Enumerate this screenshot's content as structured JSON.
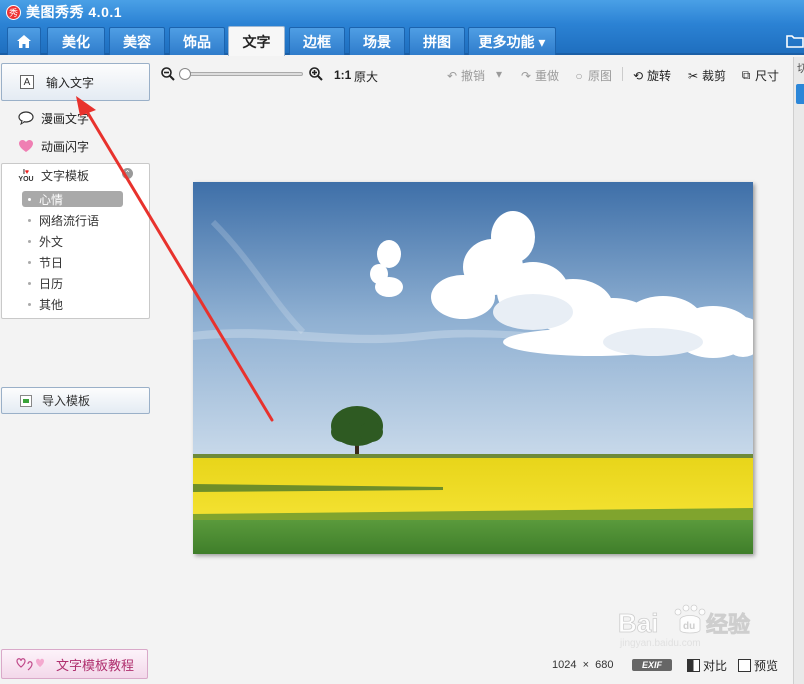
{
  "app": {
    "logo_glyph": "秀",
    "title": "美图秀秀 4.0.1"
  },
  "tabs": [
    {
      "label": "",
      "icon": "home-icon"
    },
    {
      "label": "美化"
    },
    {
      "label": "美容"
    },
    {
      "label": "饰品"
    },
    {
      "label": "文字",
      "active": true
    },
    {
      "label": "边框"
    },
    {
      "label": "场景"
    },
    {
      "label": "拼图"
    },
    {
      "label": "更多功能 ▾"
    }
  ],
  "left_panel": {
    "input_text_icon": "A",
    "input_text_label": "输入文字",
    "comic_text_label": "漫画文字",
    "animated_text_label": "动画闪字",
    "template_header": "文字模板",
    "categories": [
      "心情",
      "网络流行语",
      "外文",
      "节日",
      "日历",
      "其他"
    ],
    "selected_category": "心情",
    "import_label": "导入模板",
    "tutorial_label": "文字模板教程"
  },
  "toolbar": {
    "ratio": "1:1",
    "original_size": "原大",
    "undo": "撤销",
    "redo": "重做",
    "original_image": "原图",
    "rotate": "旋转",
    "crop": "裁剪",
    "size": "尺寸",
    "zoom_level": 0.0
  },
  "status": {
    "width": "1024",
    "times": "×",
    "height": "680",
    "exif": "EXIF",
    "compare": "对比",
    "preview": "预览"
  },
  "right_edge_text": "切",
  "watermark": {
    "brand": "Baidu",
    "suffix": "经验",
    "url": "jingyan.baidu.com"
  },
  "colors": {
    "titlebar": "#2b82d4",
    "accent": "#2b82d4",
    "annotation_arrow": "#e8322d",
    "tutorial_text": "#b0306f"
  }
}
